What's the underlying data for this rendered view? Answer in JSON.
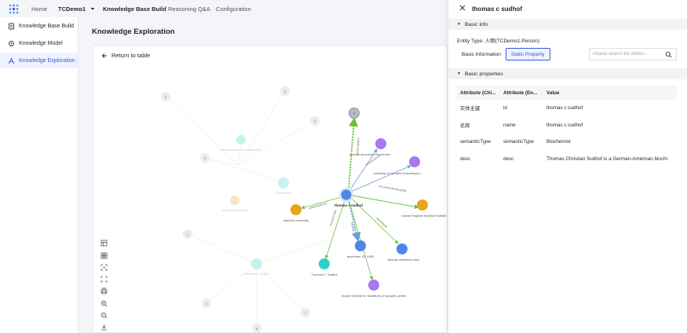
{
  "nav": {
    "home": "Home",
    "project": "TCDemo1",
    "tabs": [
      "Knowledge Base Build",
      "Reasoning Q&A",
      "Configuration"
    ]
  },
  "sidebar": {
    "items": [
      {
        "label": "Knowledge Base Build",
        "icon": "database-icon"
      },
      {
        "label": "Knowledge Model",
        "icon": "model-icon"
      },
      {
        "label": "Knowledge Exploration",
        "icon": "exploration-icon",
        "active": true
      }
    ]
  },
  "main": {
    "title": "Knowledge Exploration",
    "back_label": "Return to table"
  },
  "graph": {
    "center": {
      "label": "thomas c sudhof"
    },
    "nodes": [
      {
        "label": "german-american biochemist",
        "color": "#a678f0"
      },
      {
        "label": "plasticity of synaptic transmission",
        "color": "#a678f0"
      },
      {
        "label": "howard hughes medical institute",
        "color": "#e8a21c"
      },
      {
        "label": "thomas christian's doct",
        "color": "#4e86e8"
      },
      {
        "label": "december 22, 1955",
        "color": "#4e86e8"
      },
      {
        "label": "mouse models for mutations of synaptic genes",
        "color": "#a678f0"
      },
      {
        "label": "Thomas C. Sudhof",
        "color": "#2ed1c7"
      },
      {
        "label": "stanford university",
        "color": "#e8a21c"
      },
      {
        "label": "3",
        "color": "#b7bcc4"
      }
    ],
    "edges": [
      "hasOccupation",
      "researchArea",
      "isCurrentlyWorkingWith",
      "dateOfBirth",
      "hasAlias",
      "graduatedFrom",
      "researchTopic"
    ],
    "faded_labels": [
      "2",
      "6",
      "3",
      "3",
      "2",
      "2",
      "5",
      "7",
      "stanford university",
      "Thomas C. Sudhof",
      "german-american biochemist",
      "Biochemist"
    ]
  },
  "toolbar": [
    "layout-icon",
    "grid-icon",
    "focus-icon",
    "fullscreen-icon",
    "print-icon",
    "zoom-in-icon",
    "zoom-out-icon",
    "download-icon"
  ],
  "panel": {
    "title": "thomas c sudhof",
    "basic_info_label": "Basic info",
    "entity_type": "Entity Type: 人物(TCDemo1.Person)",
    "seg_basic": "Basic information",
    "seg_static": "Static Property",
    "search_placeholder": "Please search for attribu...",
    "basic_props_label": "Basic properties",
    "columns": [
      "Attribute (Chi...",
      "Attribute (En...",
      "Value"
    ],
    "rows": [
      [
        "实体主键",
        "id",
        "thomas c sudhof"
      ],
      [
        "名称",
        "name",
        "thomas c sudhof"
      ],
      [
        "semanticType",
        "semanticType",
        "Biochemist"
      ],
      [
        "desc",
        "desc",
        "Thomas Christian Sudhof is a German-American biochi"
      ]
    ]
  },
  "colors": {
    "accent": "#2d5bd8",
    "purple": "#a678f0",
    "orange": "#e8a21c",
    "blue": "#4e86e8",
    "teal": "#2ed1c7"
  }
}
